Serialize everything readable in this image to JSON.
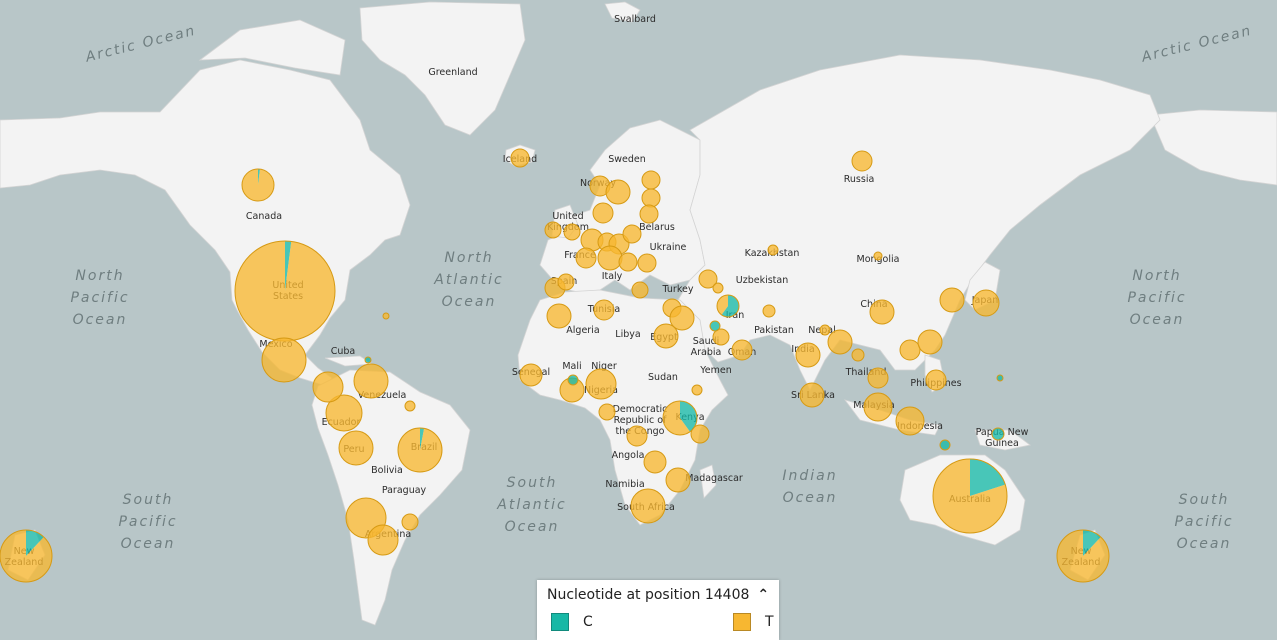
{
  "colors": {
    "ocean": "#b8c6c8",
    "land": "#f3f3f3",
    "C": "#17b8a6",
    "T": "#f7b731"
  },
  "oceans": [
    {
      "id": "arctic-ocean-west",
      "lines": [
        "Arctic Ocean"
      ]
    },
    {
      "id": "arctic-ocean-east",
      "lines": [
        "Arctic Ocean"
      ]
    },
    {
      "id": "north-pacific-west",
      "lines": [
        "North",
        "Pacific",
        "Ocean"
      ]
    },
    {
      "id": "north-pacific-east",
      "lines": [
        "North",
        "Pacific",
        "Ocean"
      ]
    },
    {
      "id": "north-atlantic",
      "lines": [
        "North",
        "Atlantic",
        "Ocean"
      ]
    },
    {
      "id": "south-atlantic",
      "lines": [
        "South",
        "Atlantic",
        "Ocean"
      ]
    },
    {
      "id": "indian-ocean",
      "lines": [
        "Indian",
        "Ocean"
      ]
    },
    {
      "id": "south-pacific-west",
      "lines": [
        "South",
        "Pacific",
        "Ocean"
      ]
    },
    {
      "id": "south-pacific-east",
      "lines": [
        "South",
        "Pacific",
        "Ocean"
      ]
    }
  ],
  "countries": [
    "Svalbard",
    "Greenland",
    "Iceland",
    "Sweden",
    "Norway",
    "Canada",
    "United Kingdom",
    "Belarus",
    "Ukraine",
    "France",
    "Spain",
    "Italy",
    "Russia",
    "Kazakhstan",
    "Mongolia",
    "Uzbekistan",
    "Turkey",
    "Iran",
    "China",
    "Japan",
    "Pakistan",
    "Nepal",
    "India",
    "Saudi Arabia",
    "Oman",
    "Yemen",
    "Egypt",
    "Libya",
    "Algeria",
    "Tunisia",
    "Mali",
    "Niger",
    "Sudan",
    "Senegal",
    "Nigeria",
    "Democratic Republic of the Congo",
    "Kenya",
    "Angola",
    "Namibia",
    "South Africa",
    "Madagascar",
    "United States",
    "Mexico",
    "Cuba",
    "Venezuela",
    "Ecuador",
    "Peru",
    "Brazil",
    "Bolivia",
    "Paraguay",
    "Argentina",
    "Thailand",
    "Philippines",
    "Malaysia",
    "Indonesia",
    "Sri Lanka",
    "Papua New Guinea",
    "Australia",
    "New Zealand"
  ],
  "legend": {
    "title": "Nucleotide at position 14408",
    "items": [
      {
        "label": "C",
        "color": "#17b8a6"
      },
      {
        "label": "T",
        "color": "#f7b731"
      }
    ]
  },
  "samples": [
    {
      "place": "United States",
      "C": 0.02,
      "T": 0.98
    },
    {
      "place": "Canada",
      "C": 0.02,
      "T": 0.98
    },
    {
      "place": "Mexico",
      "C": 0,
      "T": 1
    },
    {
      "place": "Australia",
      "C": 0.2,
      "T": 0.8
    },
    {
      "place": "New Zealand",
      "C": 0.12,
      "T": 0.88
    },
    {
      "place": "Brazil",
      "C": 0.03,
      "T": 0.97
    },
    {
      "place": "Russia",
      "C": 0,
      "T": 1
    },
    {
      "place": "Iran",
      "C": 0.6,
      "T": 0.4
    },
    {
      "place": "Kenya",
      "C": 0.4,
      "T": 0.6
    },
    {
      "place": "Papua New Guinea",
      "C": 1,
      "T": 0
    }
  ]
}
